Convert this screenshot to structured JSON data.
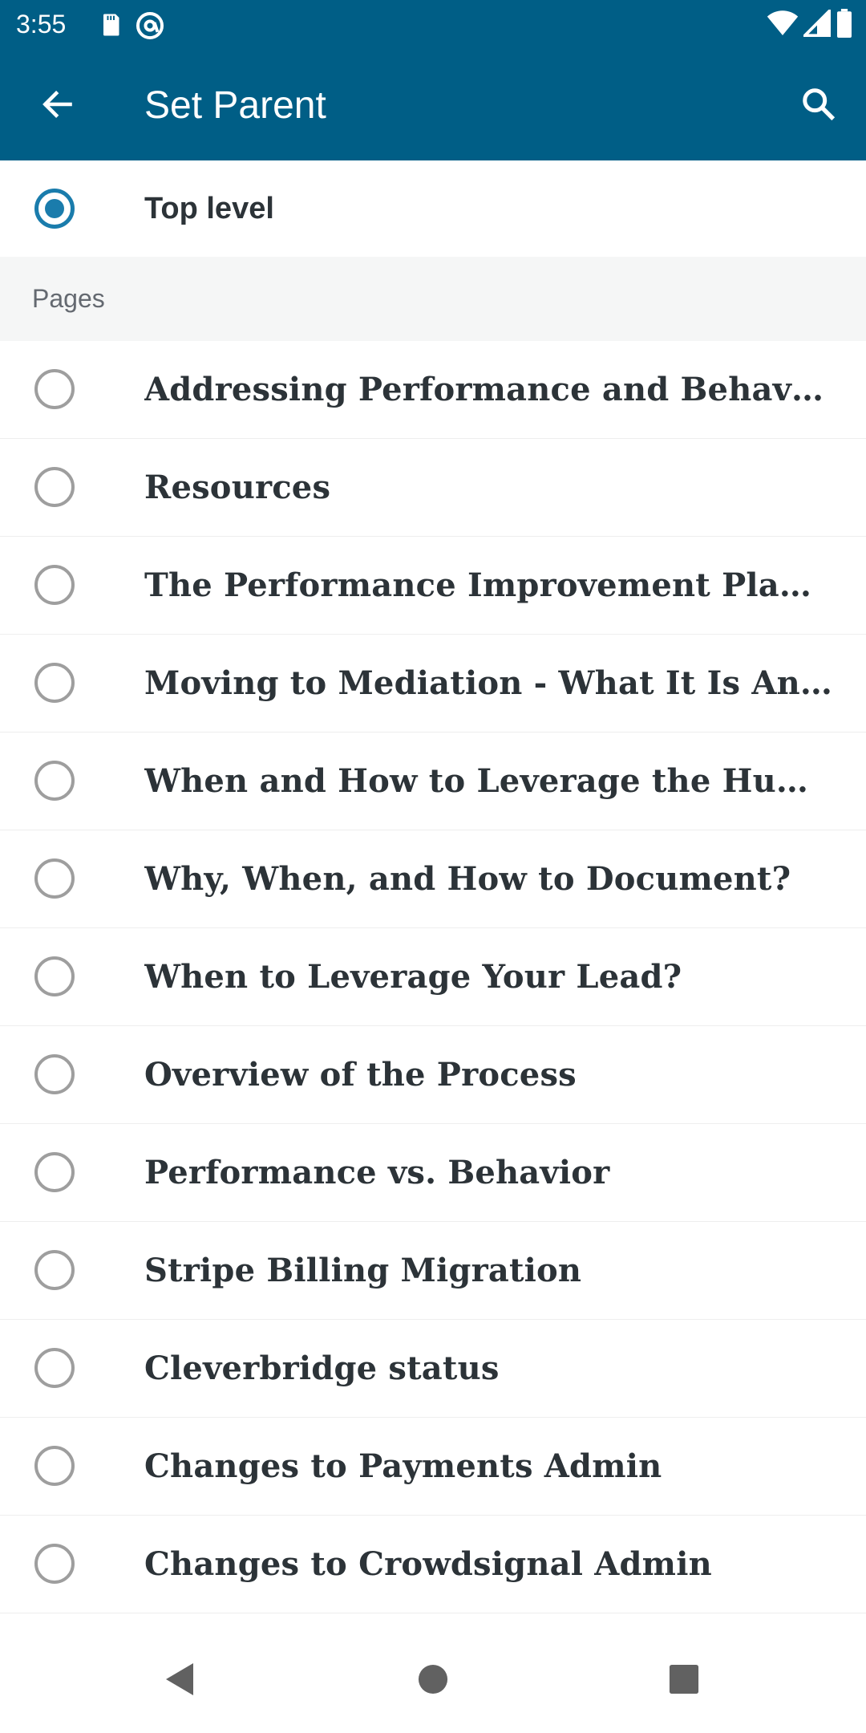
{
  "status_bar": {
    "time": "3:55",
    "icons": [
      "sd-card-icon",
      "at-sign-icon",
      "wifi-icon",
      "signal-icon",
      "battery-icon"
    ]
  },
  "app_bar": {
    "title": "Set Parent",
    "back_icon": "arrow-left-icon",
    "search_icon": "search-icon",
    "background": "#005e86"
  },
  "top_level": {
    "label": "Top level",
    "selected": true
  },
  "section": {
    "label": "Pages"
  },
  "pages": [
    {
      "label": "Addressing Performance and Behavior Concerns",
      "selected": false
    },
    {
      "label": "Resources",
      "selected": false
    },
    {
      "label": "The Performance Improvement Plan - What It Is",
      "selected": false
    },
    {
      "label": "Moving to Mediation - What It Is And When To Use It",
      "selected": false
    },
    {
      "label": "When and How to Leverage the Human Resources Team",
      "selected": false
    },
    {
      "label": "Why, When, and How to Document?",
      "selected": false
    },
    {
      "label": "When to Leverage Your Lead?",
      "selected": false
    },
    {
      "label": "Overview of the Process",
      "selected": false
    },
    {
      "label": "Performance vs. Behavior",
      "selected": false
    },
    {
      "label": "Stripe Billing Migration",
      "selected": false
    },
    {
      "label": "Cleverbridge status",
      "selected": false
    },
    {
      "label": "Changes to Payments Admin",
      "selected": false
    },
    {
      "label": "Changes to Crowdsignal Admin",
      "selected": false
    }
  ],
  "nav_bar": {
    "back_icon": "nav-back-icon",
    "home_icon": "nav-home-icon",
    "recents_icon": "nav-recents-icon"
  },
  "colors": {
    "primary": "#005e86",
    "radio_checked": "#1a7cac",
    "radio_unchecked": "#9e9e9e",
    "text": "#2c3338",
    "section_bg": "#f5f6f6"
  }
}
